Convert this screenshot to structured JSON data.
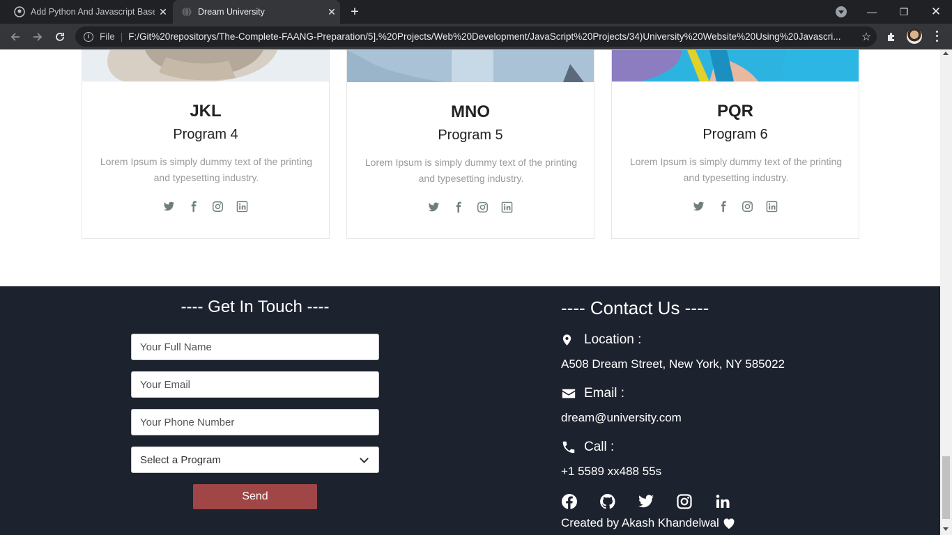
{
  "browser": {
    "tabs": [
      {
        "title": "Add Python And Javascript Based",
        "active": false
      },
      {
        "title": "Dream University",
        "active": true
      }
    ],
    "url_scheme_label": "File",
    "url": "F:/Git%20repositorys/The-Complete-FAANG-Preparation/5].%20Projects/Web%20Development/JavaScript%20Projects/34)University%20Website%20Using%20Javascri..."
  },
  "programs": [
    {
      "name": "JKL",
      "program": "Program 4",
      "description": "Lorem Ipsum is simply dummy text of the printing and typesetting industry."
    },
    {
      "name": "MNO",
      "program": "Program 5",
      "description": "Lorem Ipsum is simply dummy text of the printing and typesetting industry."
    },
    {
      "name": "PQR",
      "program": "Program 6",
      "description": "Lorem Ipsum is simply dummy text of the printing and typesetting industry."
    }
  ],
  "contact_form": {
    "title": "---- Get In Touch ----",
    "name_placeholder": "Your Full Name",
    "email_placeholder": "Your Email",
    "phone_placeholder": "Your Phone Number",
    "program_select": "Select a Program",
    "send_label": "Send"
  },
  "contact_info": {
    "title": "---- Contact Us ----",
    "location_label": "Location :",
    "location_value": "A508 Dream Street, New York, NY 585022",
    "email_label": "Email :",
    "email_value": "dream@university.com",
    "call_label": "Call :",
    "call_value": "+1 5589 xx488 55s",
    "credit": "Created by Akash Khandelwal"
  },
  "colors": {
    "footer_bg": "#1d232e",
    "send_button": "#a04646",
    "social_icon": "#6f7f78"
  }
}
